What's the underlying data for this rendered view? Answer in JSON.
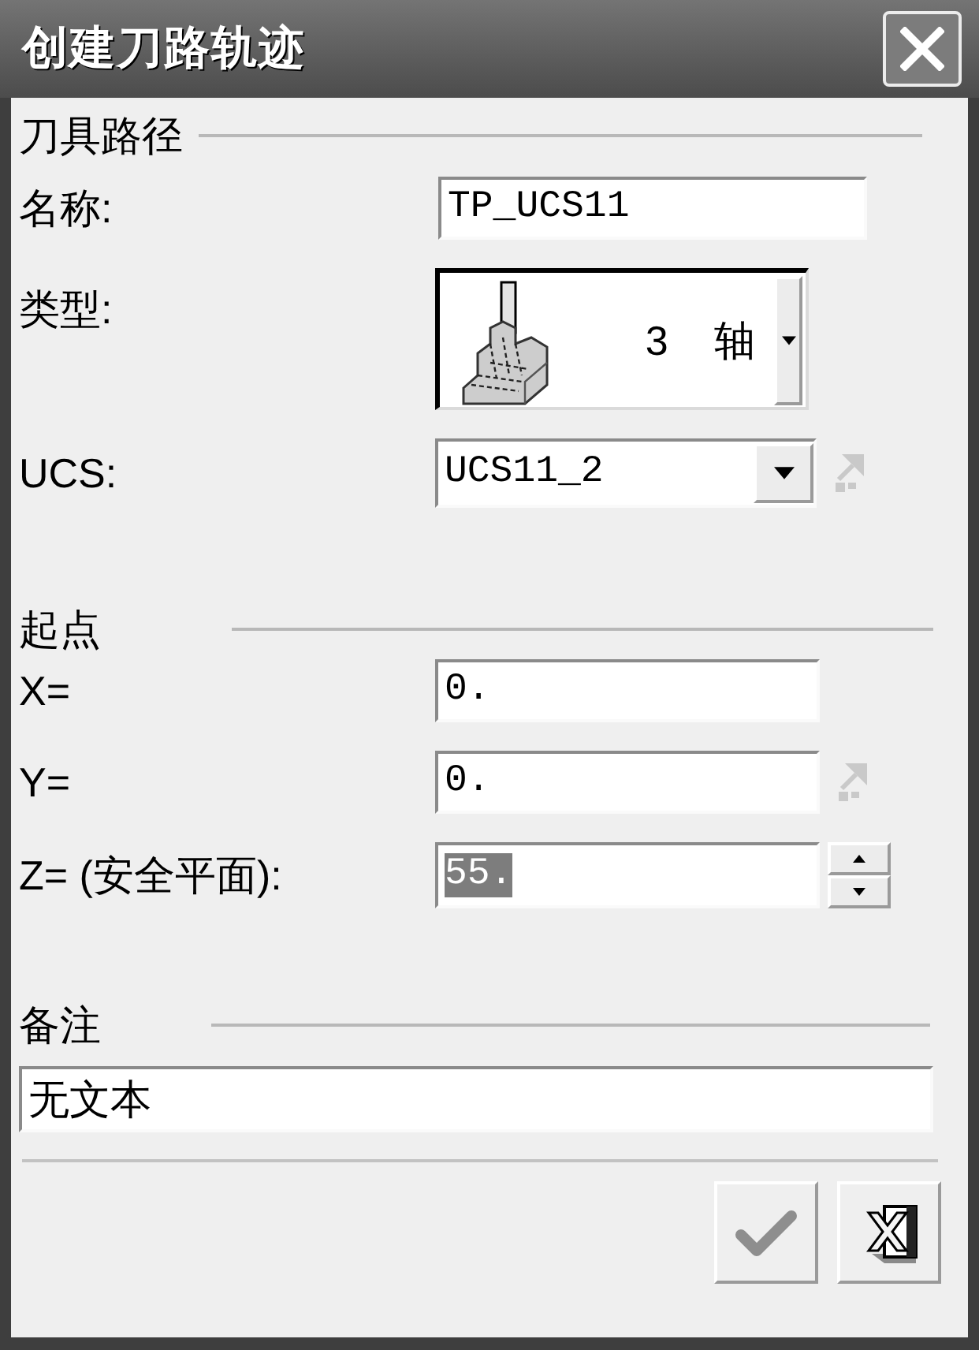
{
  "window": {
    "title": "创建刀路轨迹"
  },
  "toolpath": {
    "title": "刀具路径",
    "fields": [
      {
        "kind": "text",
        "label": "名称:",
        "value": "TP_UCS11"
      },
      {
        "kind": "type_picker",
        "label": "类型:",
        "value": "3 轴"
      },
      {
        "kind": "dropdown",
        "label": "UCS:",
        "value": "UCS11_2",
        "pick_icon": {
          "disabled": true
        }
      }
    ]
  },
  "start_point": {
    "title": "起点",
    "fields": [
      {
        "kind": "text",
        "label": "X=",
        "value": "0."
      },
      {
        "kind": "text",
        "label": "Y=",
        "value": "0.",
        "pick_icon": {
          "disabled": true
        }
      },
      {
        "kind": "spin",
        "label": "Z= (安全平面):",
        "value": "55.",
        "value_selected": true
      }
    ]
  },
  "remarks": {
    "title": "备注",
    "value": "无文本"
  },
  "buttons": [
    {
      "kind": "ok"
    },
    {
      "kind": "cancel"
    }
  ]
}
